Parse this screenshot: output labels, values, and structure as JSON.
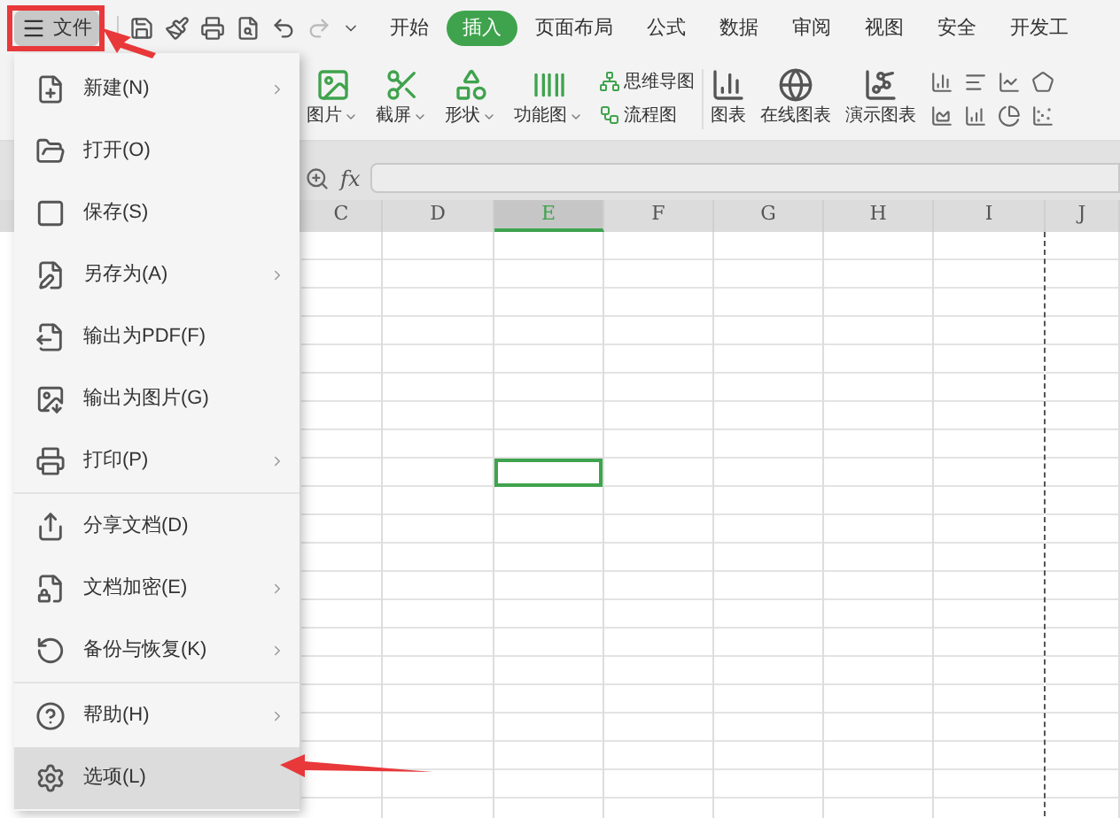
{
  "file_button": {
    "label": "文件"
  },
  "tabs": [
    {
      "label": "开始",
      "selected": false
    },
    {
      "label": "插入",
      "selected": true
    },
    {
      "label": "页面布局",
      "selected": false
    },
    {
      "label": "公式",
      "selected": false
    },
    {
      "label": "数据",
      "selected": false
    },
    {
      "label": "审阅",
      "selected": false
    },
    {
      "label": "视图",
      "selected": false
    },
    {
      "label": "安全",
      "selected": false
    },
    {
      "label": "开发工",
      "selected": false
    }
  ],
  "ribbon": {
    "large_items": [
      {
        "label": "图片",
        "dropdown": true
      },
      {
        "label": "截屏",
        "dropdown": true
      },
      {
        "label": "形状",
        "dropdown": true
      },
      {
        "label": "功能图",
        "dropdown": true
      }
    ],
    "stacked_items": [
      {
        "label": "思维导图"
      },
      {
        "label": "流程图"
      }
    ],
    "chart_items": [
      {
        "label": "图表"
      },
      {
        "label": "在线图表"
      },
      {
        "label": "演示图表"
      }
    ]
  },
  "formula_bar": {
    "fx": "fx"
  },
  "columns": [
    {
      "label": "C",
      "selected": false
    },
    {
      "label": "D",
      "selected": false
    },
    {
      "label": "E",
      "selected": true
    },
    {
      "label": "F",
      "selected": false
    },
    {
      "label": "G",
      "selected": false
    },
    {
      "label": "H",
      "selected": false
    },
    {
      "label": "I",
      "selected": false
    },
    {
      "label": "J",
      "selected": false
    }
  ],
  "file_menu": {
    "groups": [
      [
        {
          "label": "新建(N)",
          "submenu": true,
          "selected": false
        },
        {
          "label": "打开(O)",
          "submenu": false,
          "selected": false
        },
        {
          "label": "保存(S)",
          "submenu": false,
          "selected": false
        },
        {
          "label": "另存为(A)",
          "submenu": true,
          "selected": false
        },
        {
          "label": "输出为PDF(F)",
          "submenu": false,
          "selected": false
        },
        {
          "label": "输出为图片(G)",
          "submenu": false,
          "selected": false
        },
        {
          "label": "打印(P)",
          "submenu": true,
          "selected": false
        }
      ],
      [
        {
          "label": "分享文档(D)",
          "submenu": false,
          "selected": false
        },
        {
          "label": "文档加密(E)",
          "submenu": true,
          "selected": false
        },
        {
          "label": "备份与恢复(K)",
          "submenu": true,
          "selected": false
        }
      ],
      [
        {
          "label": "帮助(H)",
          "submenu": true,
          "selected": false
        },
        {
          "label": "选项(L)",
          "submenu": false,
          "selected": true
        }
      ]
    ]
  }
}
